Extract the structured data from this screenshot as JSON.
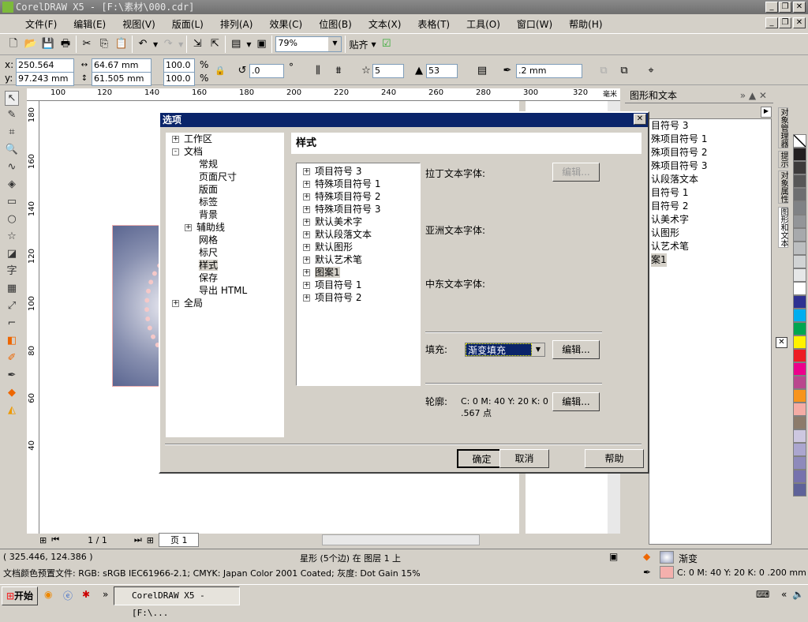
{
  "app": {
    "title": "CorelDRAW X5 - [F:\\素材\\000.cdr]"
  },
  "menu": [
    "文件(F)",
    "编辑(E)",
    "视图(V)",
    "版面(L)",
    "排列(A)",
    "效果(C)",
    "位图(B)",
    "文本(X)",
    "表格(T)",
    "工具(O)",
    "窗口(W)",
    "帮助(H)"
  ],
  "toolbar": {
    "zoom": "79%",
    "snap_label": "贴齐"
  },
  "property_bar": {
    "x": "250.564 mm",
    "y": "97.243 mm",
    "width": "64.67 mm",
    "height": "61.505 mm",
    "scale_x": "100.0",
    "scale_y": "100.0",
    "percent": "%",
    "angle": ".0",
    "degree": "°",
    "points": "5",
    "sharpness": "53",
    "outline": ".2 mm"
  },
  "rulers": {
    "top": [
      "100",
      "120",
      "140",
      "160",
      "180",
      "200",
      "220",
      "240",
      "260",
      "280",
      "300",
      "320"
    ],
    "left": [
      "180",
      "160",
      "140",
      "120",
      "100",
      "80",
      "60",
      "40"
    ],
    "unit": "毫米"
  },
  "dialog": {
    "title": "选项",
    "nav_tree": [
      {
        "label": "工作区",
        "level": 0,
        "expander": "+"
      },
      {
        "label": "文档",
        "level": 0,
        "expander": "-"
      },
      {
        "label": "常规",
        "level": 1
      },
      {
        "label": "页面尺寸",
        "level": 1
      },
      {
        "label": "版面",
        "level": 1
      },
      {
        "label": "标签",
        "level": 1
      },
      {
        "label": "背景",
        "level": 1
      },
      {
        "label": "辅助线",
        "level": 1,
        "expander": "+"
      },
      {
        "label": "网格",
        "level": 1
      },
      {
        "label": "标尺",
        "level": 1
      },
      {
        "label": "样式",
        "level": 1,
        "selected": true
      },
      {
        "label": "保存",
        "level": 1
      },
      {
        "label": "导出 HTML",
        "level": 1
      },
      {
        "label": "全局",
        "level": 0,
        "expander": "+"
      }
    ],
    "section_title": "样式",
    "styles": [
      "项目符号 3",
      "特殊项目符号 1",
      "特殊项目符号 2",
      "特殊项目符号 3",
      "默认美术字",
      "默认段落文本",
      "默认图形",
      "默认艺术笔",
      "图案1",
      "项目符号 1",
      "项目符号 2"
    ],
    "selected_style": "图案1",
    "latin_font_label": "拉丁文本字体:",
    "asian_font_label": "亚洲文本字体:",
    "me_font_label": "中东文本字体:",
    "edit_label": "编辑...",
    "fill_label": "填充:",
    "fill_value": "渐变填充",
    "outline_label": "轮廓:",
    "outline_value_1": "C: 0 M: 40 Y: 20 K: 0",
    "outline_value_2": ".567 点",
    "ok": "确定",
    "cancel": "取消",
    "help": "帮助"
  },
  "docker": {
    "title": "图形和文本",
    "items": [
      "目符号 3",
      "殊项目符号 1",
      "殊项目符号 2",
      "殊项目符号 3",
      "认段落文本",
      "目符号 1",
      "目符号 2",
      "认美术字",
      "认图形",
      "认艺术笔",
      "案1"
    ],
    "tabs": [
      "对象管理器",
      "提示",
      "对象属性",
      "图形和文本"
    ]
  },
  "palette": [
    "#ffffff",
    "#231f20",
    "#3d3b3b",
    "#575757",
    "#6d6e70",
    "#808285",
    "#939598",
    "#a7a9ac",
    "#bcbec0",
    "#d1d3d4",
    "#e6e7e8",
    "#ffffff",
    "#2e3192",
    "#00aeef",
    "#00a651",
    "#fff200",
    "#ed1c24",
    "#ec008c",
    "#b9478e",
    "#f7941d",
    "#f4aca5",
    "#8c7b6b",
    "#cdc7e0",
    "#aba6cf",
    "#8e8abb",
    "#7672ad",
    "#5e6299"
  ],
  "page_nav": {
    "page_count": "1 / 1",
    "page_tab": "页 1"
  },
  "status": {
    "coords": "( 325.446, 124.386 )",
    "object": "星形 (5个边) 在 图层 1 上",
    "color_profile": "文档颜色预置文件: RGB: sRGB IEC61966-2.1; CMYK: Japan Color 2001 Coated; 灰度: Dot Gain 15%",
    "fill": "渐变",
    "outline": "C: 0 M: 40 Y: 20 K: 0  .200 mm",
    "outline_color": "#f4b0ad"
  },
  "taskbar": {
    "start": "开始",
    "task": "CorelDRAW X5 - [F:\\..."
  }
}
